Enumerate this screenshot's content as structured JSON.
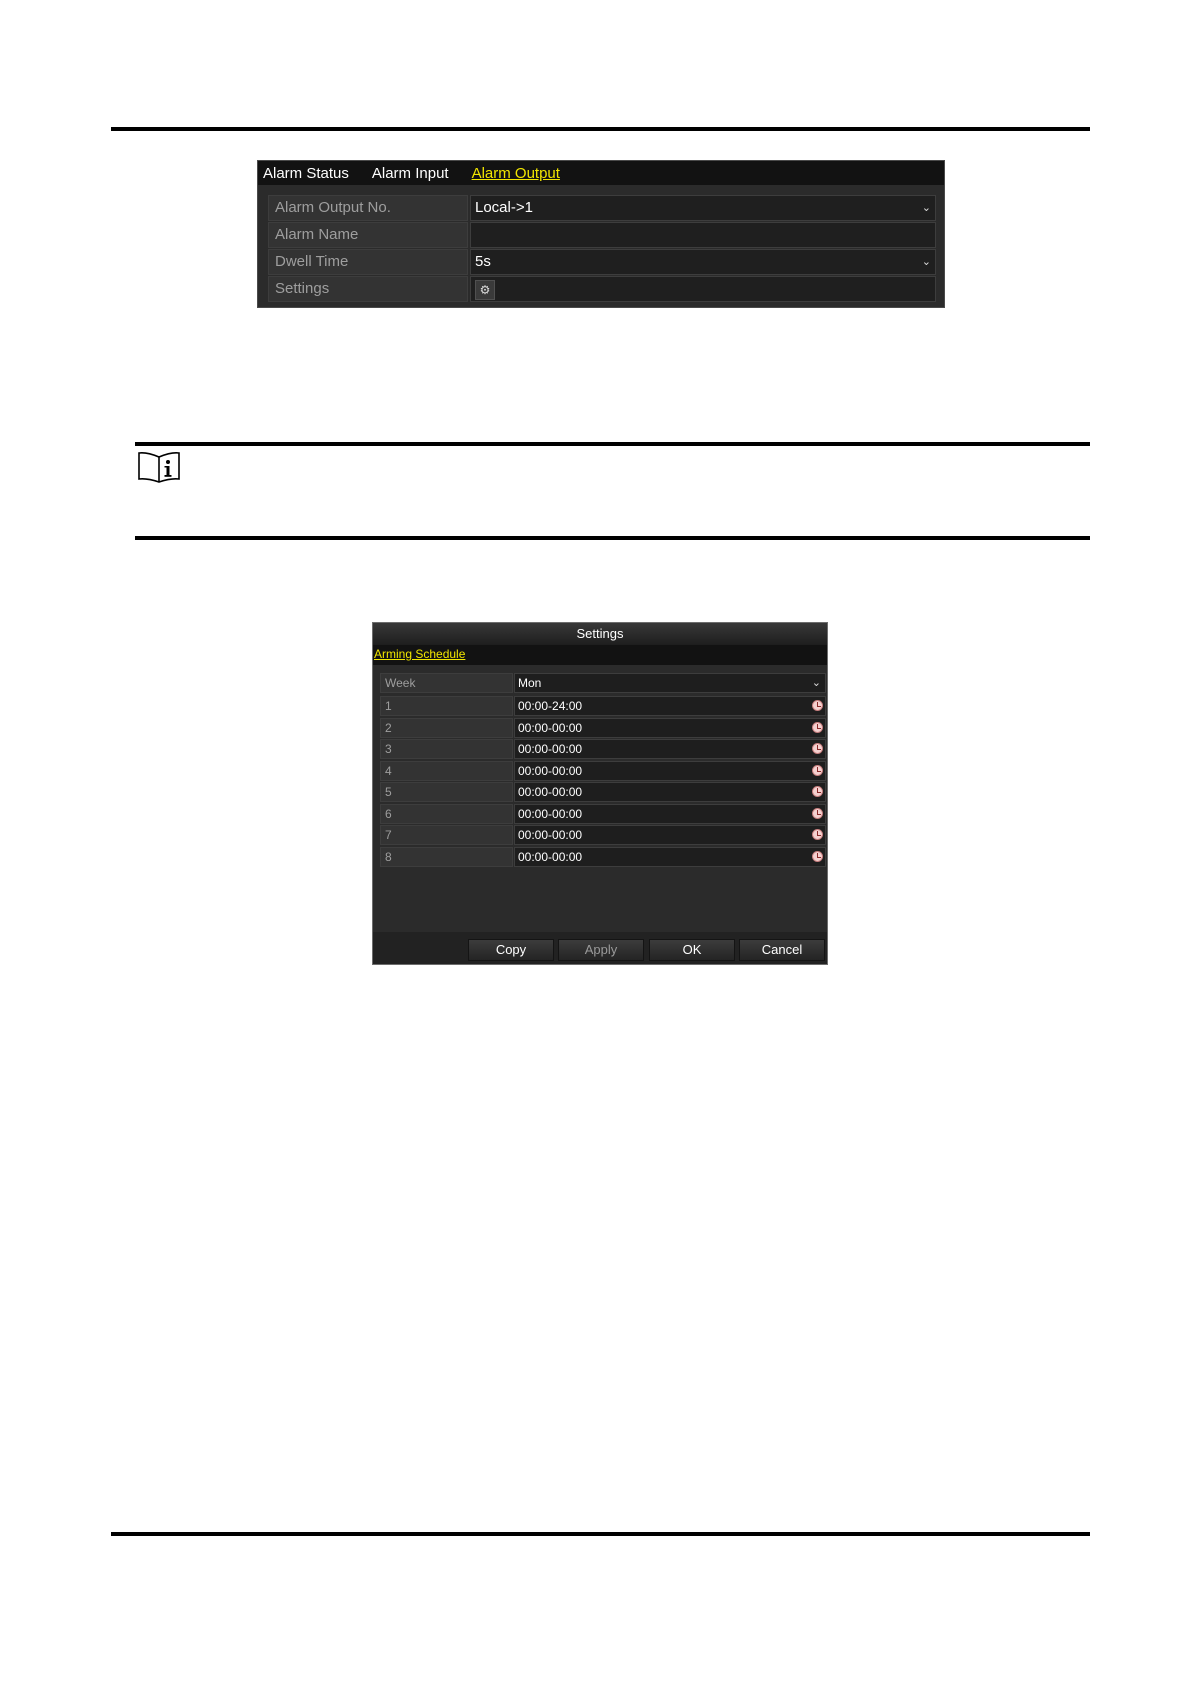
{
  "alarm_output": {
    "tabs": [
      {
        "label": "Alarm Status"
      },
      {
        "label": "Alarm Input"
      },
      {
        "label": "Alarm Output"
      }
    ],
    "active_tab": "Alarm Output",
    "rows": {
      "output_no": {
        "label": "Alarm Output No.",
        "value": "Local->1"
      },
      "name": {
        "label": "Alarm Name",
        "value": ""
      },
      "dwell_time": {
        "label": "Dwell Time",
        "value": "5s"
      },
      "settings": {
        "label": "Settings",
        "icon": "gear-icon"
      }
    }
  },
  "note": {
    "icon": "note-icon"
  },
  "settings_dialog": {
    "title": "Settings",
    "tab": "Arming Schedule",
    "week": {
      "label": "Week",
      "value": "Mon"
    },
    "periods": [
      {
        "label": "1",
        "value": "00:00-24:00"
      },
      {
        "label": "2",
        "value": "00:00-00:00"
      },
      {
        "label": "3",
        "value": "00:00-00:00"
      },
      {
        "label": "4",
        "value": "00:00-00:00"
      },
      {
        "label": "5",
        "value": "00:00-00:00"
      },
      {
        "label": "6",
        "value": "00:00-00:00"
      },
      {
        "label": "7",
        "value": "00:00-00:00"
      },
      {
        "label": "8",
        "value": "00:00-00:00"
      }
    ],
    "buttons": {
      "copy": "Copy",
      "apply": "Apply",
      "ok": "OK",
      "cancel": "Cancel"
    }
  }
}
